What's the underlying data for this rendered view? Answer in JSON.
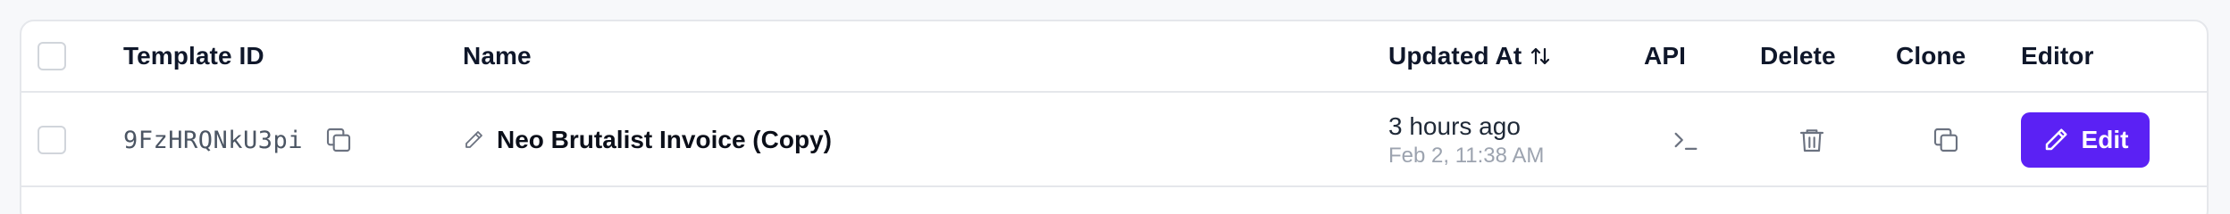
{
  "header": {
    "template_id": "Template ID",
    "name": "Name",
    "updated_at": "Updated At",
    "api": "API",
    "delete": "Delete",
    "clone": "Clone",
    "editor": "Editor"
  },
  "rows": [
    {
      "template_id": "9FzHRQNkU3pi",
      "name": "Neo Brutalist Invoice (Copy)",
      "updated_relative": "3 hours ago",
      "updated_absolute": "Feb 2, 11:38 AM",
      "edit_label": "Edit"
    }
  ],
  "colors": {
    "accent": "#5b21f4",
    "border": "#e5e7eb",
    "muted_text": "#9ca3af"
  },
  "icons": {
    "sort": "sort-arrows-icon",
    "copy": "copy-icon",
    "pencil": "pencil-icon",
    "terminal": "terminal-icon",
    "trash": "trash-icon",
    "clone": "clone-icon"
  }
}
